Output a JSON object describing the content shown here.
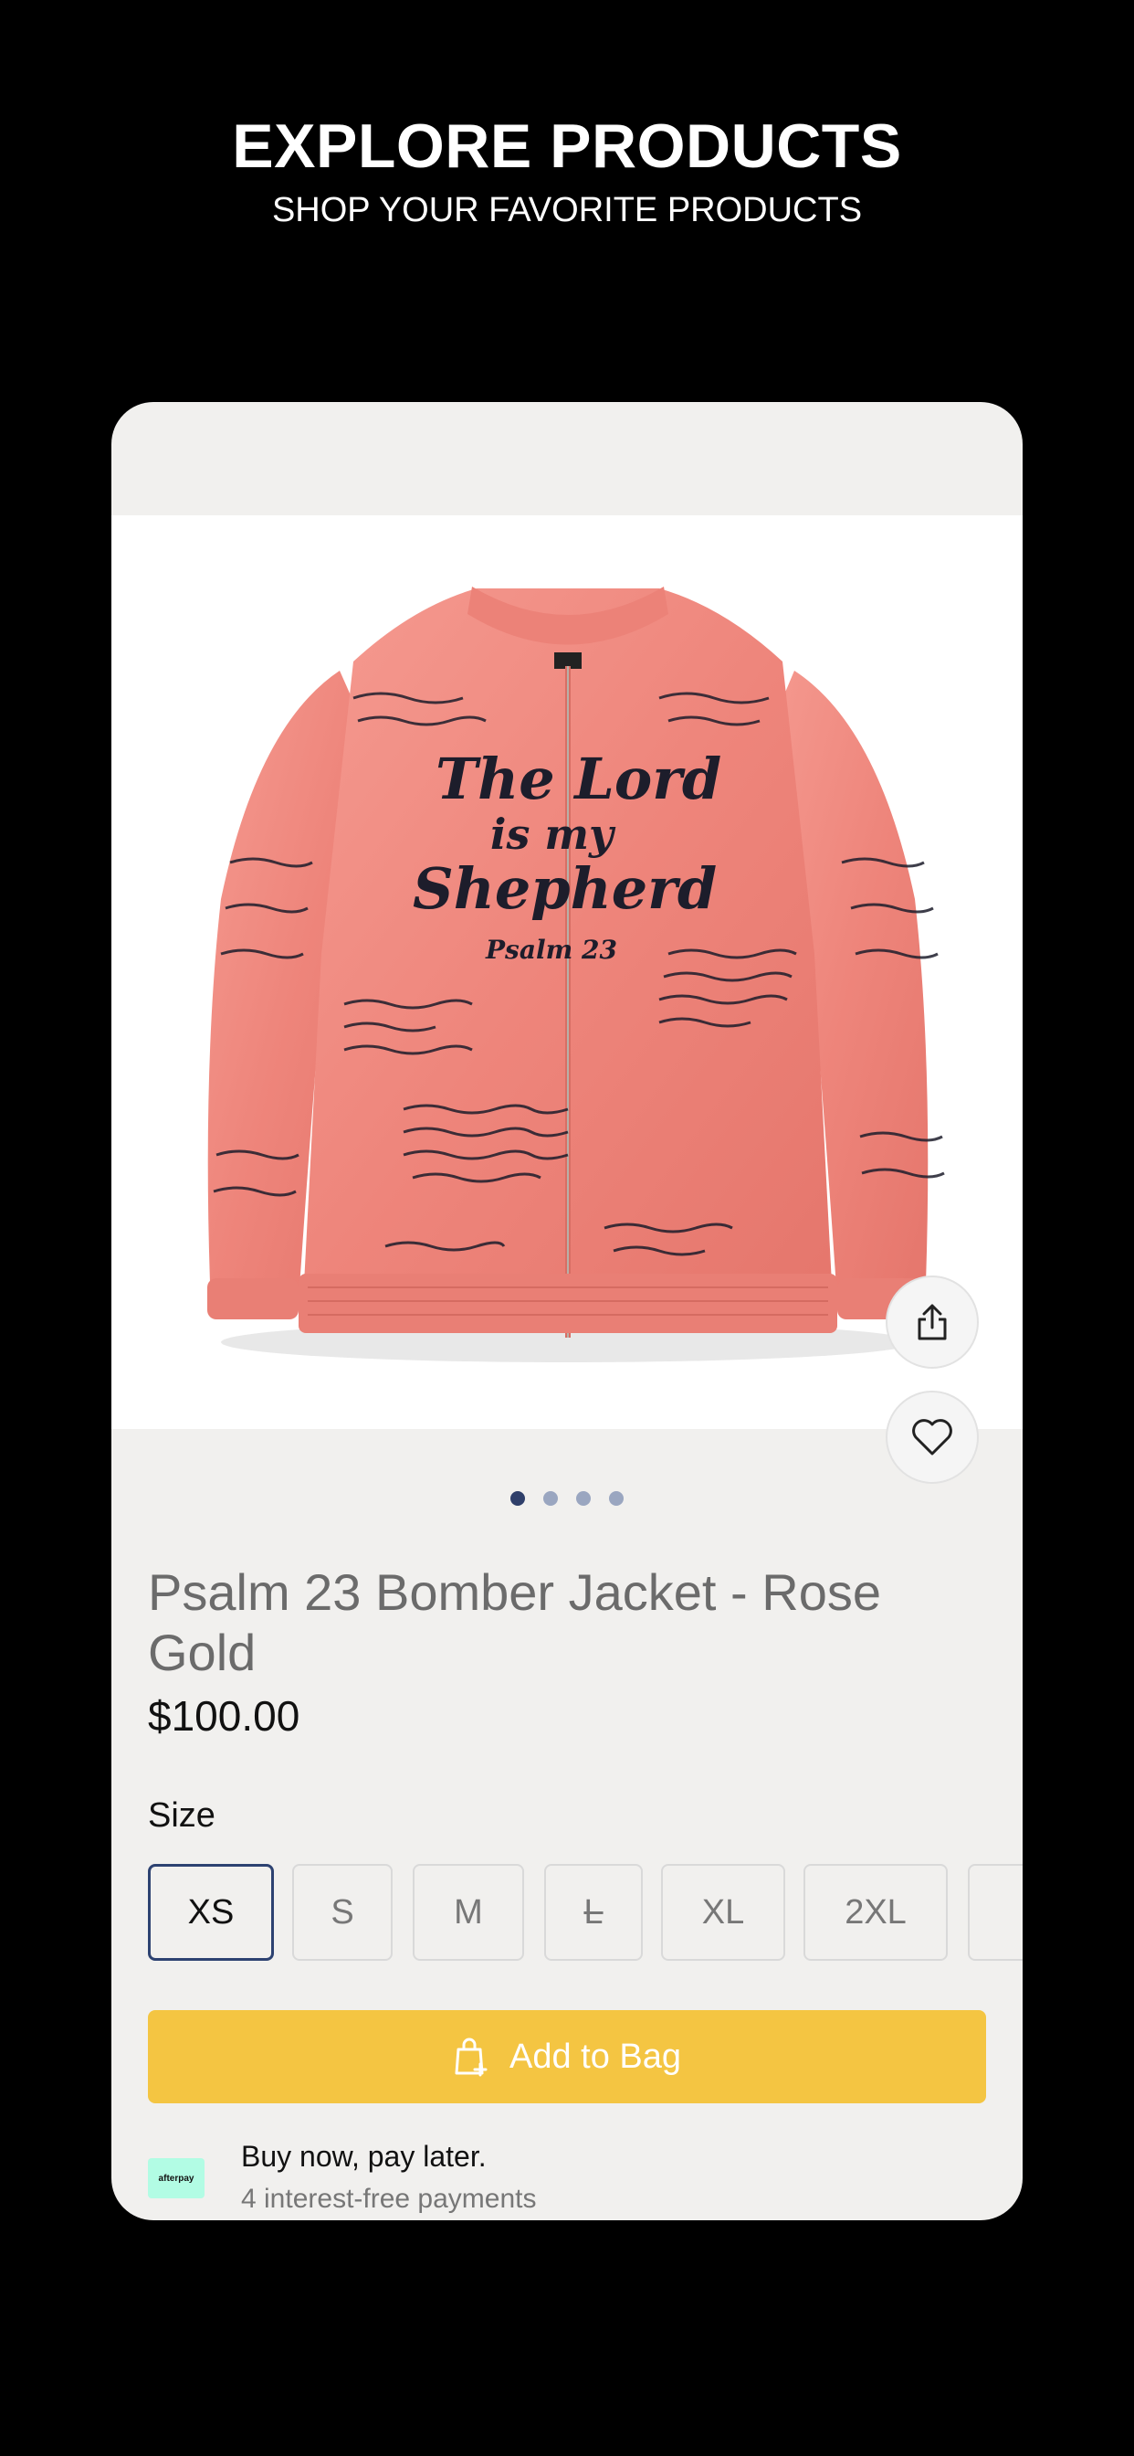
{
  "header": {
    "title": "EXPLORE PRODUCTS",
    "subtitle": "SHOP YOUR FAVORITE PRODUCTS"
  },
  "product": {
    "name": "Psalm 23 Bomber Jacket - Rose Gold",
    "price": "$100.00",
    "image": {
      "jacket_color": "#f08a80",
      "print_lines": [
        "The Lord",
        "is my",
        "Shepherd",
        "Psalm 23"
      ]
    },
    "gallery": {
      "total_images": 4,
      "active_index": 0
    }
  },
  "size": {
    "label": "Size",
    "options": [
      "XS",
      "S",
      "M",
      "L",
      "XL",
      "2XL"
    ],
    "selected": "XS"
  },
  "actions": {
    "add_to_bag": "Add to Bag",
    "share_icon": "share-icon",
    "wishlist_icon": "heart-icon"
  },
  "afterpay": {
    "logo_text": "afterpay",
    "title": "Buy now, pay later.",
    "subtitle": "4 interest-free payments"
  },
  "colors": {
    "background": "#000000",
    "card": "#f1f0ee",
    "accent_button": "#f4c542",
    "selected_border": "#2d4271",
    "afterpay_mint": "#b2fce4"
  }
}
